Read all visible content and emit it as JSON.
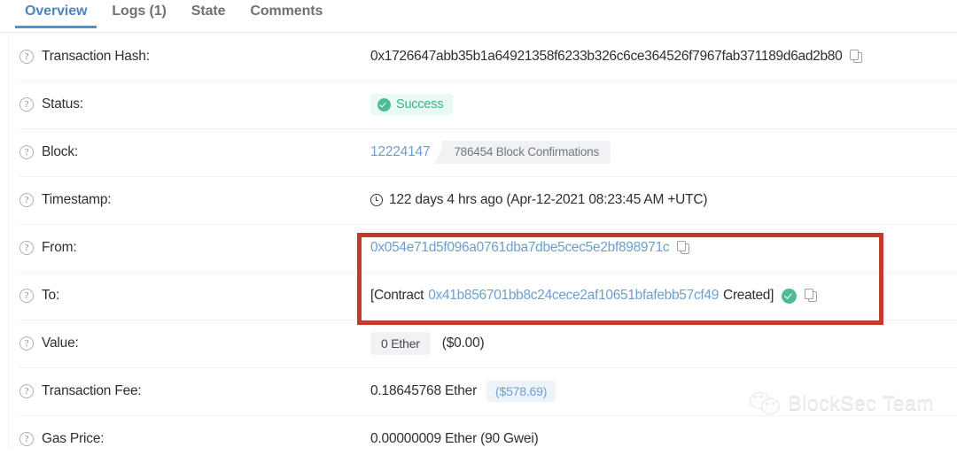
{
  "tabs": [
    {
      "label": "Overview",
      "active": true
    },
    {
      "label": "Logs (1)",
      "active": false
    },
    {
      "label": "State",
      "active": false
    },
    {
      "label": "Comments",
      "active": false
    }
  ],
  "rows": {
    "transaction_hash": {
      "label": "Transaction Hash:",
      "value": "0x1726647abb35b1a64921358f6233b326c6ce364526f7967fab371189d6ad2b80"
    },
    "status": {
      "label": "Status:",
      "value": "Success"
    },
    "block": {
      "label": "Block:",
      "number": "12224147",
      "confirmations": "786454 Block Confirmations"
    },
    "timestamp": {
      "label": "Timestamp:",
      "value": "122 days 4 hrs ago (Apr-12-2021 08:23:45 AM +UTC)"
    },
    "from": {
      "label": "From:",
      "address": "0x054e71d5f096a0761dba7dbe5cec5e2bf898971c"
    },
    "to": {
      "label": "To:",
      "prefix": "[Contract",
      "address": "0x41b856701bb8c24cece2af10651bfafebb57cf49",
      "suffix": "Created]"
    },
    "value": {
      "label": "Value:",
      "ether": "0 Ether",
      "fiat": "($0.00)"
    },
    "transaction_fee": {
      "label": "Transaction Fee:",
      "ether": "0.18645768 Ether",
      "fiat": "($578.69)"
    },
    "gas_price": {
      "label": "Gas Price:",
      "value": "0.00000009 Ether (90 Gwei)"
    }
  },
  "icons": {
    "help": "?"
  },
  "watermark": {
    "text": "BlockSec Team"
  },
  "colors": {
    "accent_blue": "#5a8fc4",
    "link_blue": "#6c9fd1",
    "success_green": "#4dbb97",
    "highlight_red": "#c3392b"
  }
}
